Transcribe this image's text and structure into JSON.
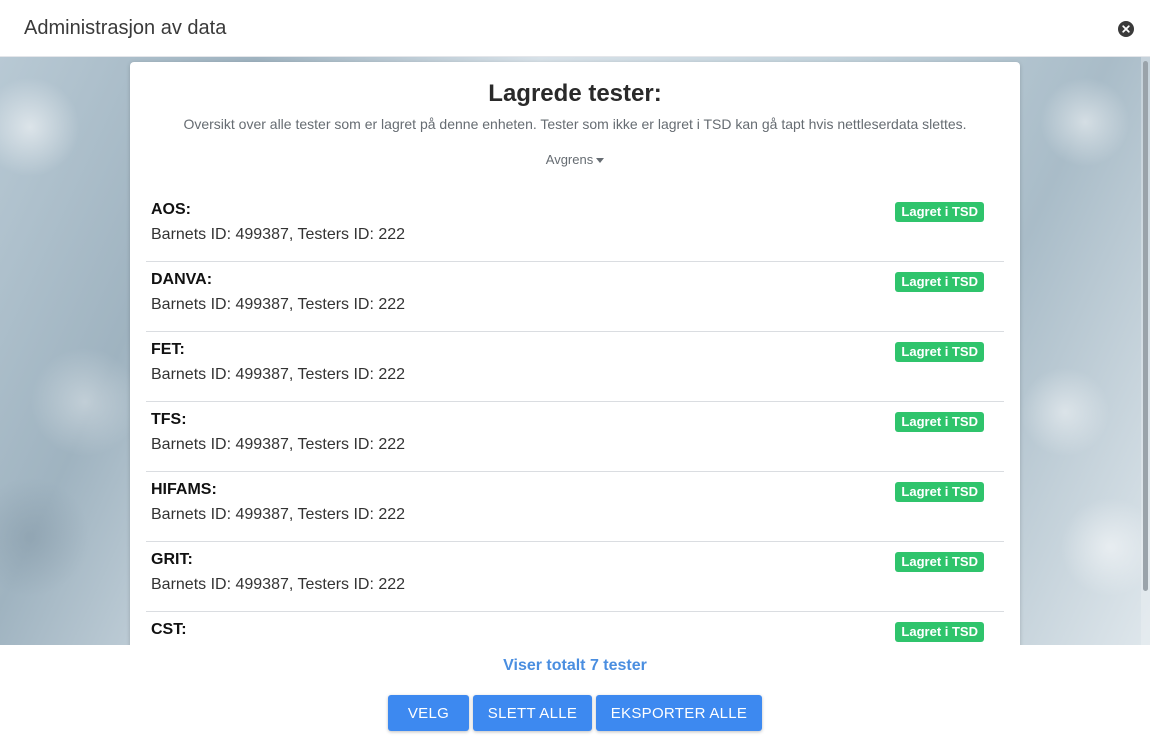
{
  "window": {
    "title": "Administrasjon av data",
    "close_icon": "close-icon"
  },
  "card": {
    "title": "Lagrede tester:",
    "subtitle": "Oversikt over alle tester som er lagret på denne enheten. Tester som ikke er lagret i TSD kan gå tapt hvis nettleserdata slettes.",
    "filter_label": "Avgrens",
    "filter_icon": "caret-down-icon"
  },
  "tests": [
    {
      "name": "AOS:",
      "detail": "Barnets ID: 499387, Testers ID: 222",
      "status": "Lagret i TSD"
    },
    {
      "name": "DANVA:",
      "detail": "Barnets ID: 499387, Testers ID: 222",
      "status": "Lagret i TSD"
    },
    {
      "name": "FET:",
      "detail": "Barnets ID: 499387, Testers ID: 222",
      "status": "Lagret i TSD"
    },
    {
      "name": "TFS:",
      "detail": "Barnets ID: 499387, Testers ID: 222",
      "status": "Lagret i TSD"
    },
    {
      "name": "HIFAMS:",
      "detail": "Barnets ID: 499387, Testers ID: 222",
      "status": "Lagret i TSD"
    },
    {
      "name": "GRIT:",
      "detail": "Barnets ID: 499387, Testers ID: 222",
      "status": "Lagret i TSD"
    },
    {
      "name": "CST:",
      "detail": "",
      "status": "Lagret i TSD"
    }
  ],
  "footer": {
    "total_text": "Viser totalt 7 tester",
    "buttons": {
      "select": "VELG",
      "delete_all": "SLETT ALLE",
      "export_all": "EKSPORTER ALLE"
    }
  },
  "colors": {
    "badge": "#2fc46c",
    "button": "#3d89f0",
    "total_text": "#4a8ee0"
  }
}
